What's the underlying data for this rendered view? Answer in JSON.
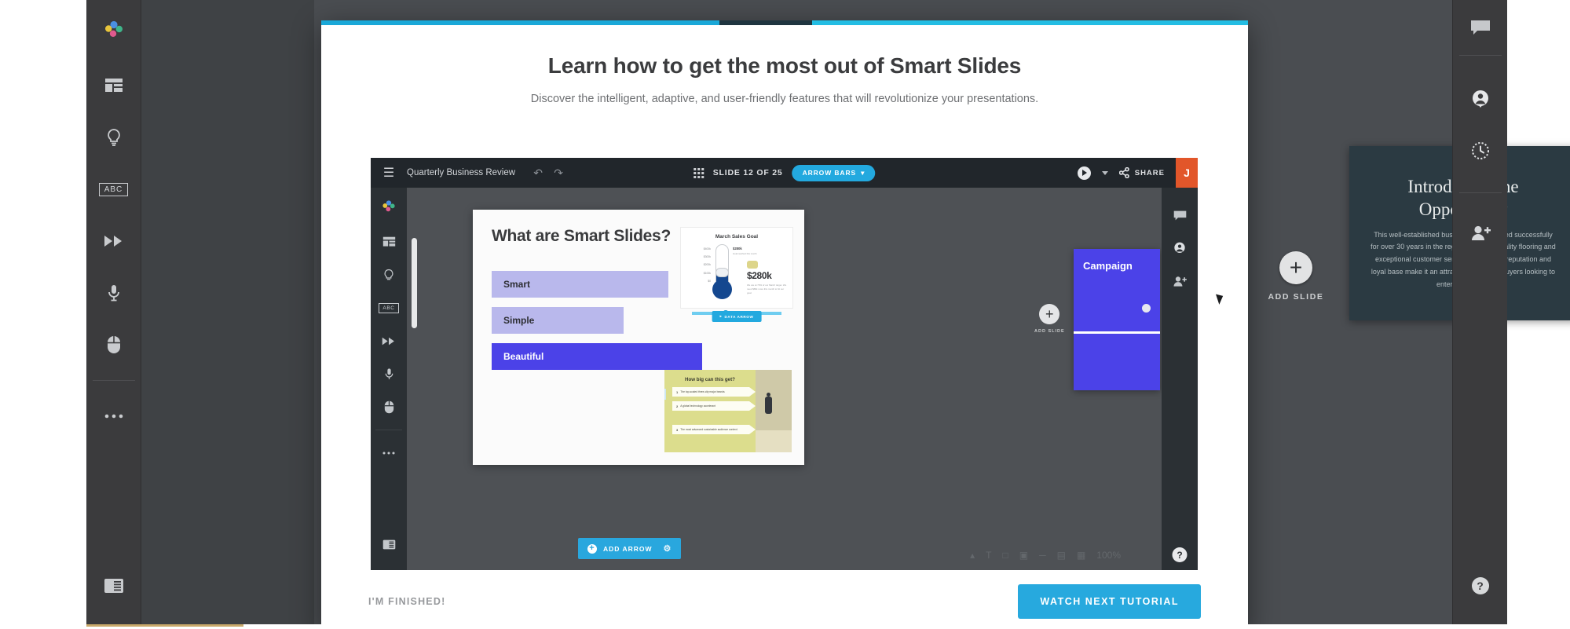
{
  "left_rail": {
    "items": [
      {
        "name": "app-logo-icon",
        "label": "Smart Slides"
      },
      {
        "name": "layouts-icon",
        "label": "Layouts"
      },
      {
        "name": "lightbulb-icon",
        "label": "Ideas"
      },
      {
        "name": "abc-icon",
        "label": "ABC"
      },
      {
        "name": "fast-forward-icon",
        "label": "Transitions"
      },
      {
        "name": "microphone-icon",
        "label": "Record"
      },
      {
        "name": "mouse-icon",
        "label": "Interact"
      },
      {
        "name": "more-options-icon",
        "label": "More"
      },
      {
        "name": "notes-panel-icon",
        "label": "Notes"
      }
    ]
  },
  "right_rail": {
    "items": [
      {
        "name": "comment-icon",
        "label": "Comments"
      },
      {
        "name": "account-icon",
        "label": "Account"
      },
      {
        "name": "history-icon",
        "label": "Version history"
      },
      {
        "name": "add-person-icon",
        "label": "Invite"
      },
      {
        "name": "help-icon",
        "label": "Help"
      }
    ]
  },
  "background": {
    "add_slide_label": "ADD SLIDE",
    "plus_glyph": "+",
    "dark_slide": {
      "title": "Introducing the Opportunity",
      "body": "This well-established business has operated successfully for over 30 years in the region with high quality flooring and exceptional customer service. The strong reputation and loyal base make it an attractive option for buyers looking to enter the market."
    }
  },
  "modal": {
    "title": "Learn how to get the most out of Smart Slides",
    "subtitle": "Discover the intelligent, adaptive, and user-friendly features that will revolutionize your presentations.",
    "finished_label": "I'M FINISHED!",
    "next_label": "WATCH NEXT TUTORIAL",
    "accent_color": "#27a9de"
  },
  "embed": {
    "topbar": {
      "menu_glyph": "☰",
      "doc_title": "Quarterly Business Review",
      "undo_glyph": "↶",
      "redo_glyph": "↷",
      "slide_counter": "SLIDE 12 OF 25",
      "mode_badge": "ARROW BARS",
      "badge_caret": "▾",
      "share_label": "SHARE",
      "avatar_initial": "J"
    },
    "rail": {
      "items": [
        {
          "name": "app-logo-icon",
          "label": "Smart Slides"
        },
        {
          "name": "layouts-icon",
          "label": "Layouts"
        },
        {
          "name": "lightbulb-icon",
          "label": "Ideas"
        },
        {
          "name": "abc-icon",
          "label": "ABC"
        },
        {
          "name": "fast-forward-icon",
          "label": "Transitions"
        },
        {
          "name": "microphone-icon",
          "label": "Record"
        },
        {
          "name": "mouse-icon",
          "label": "Interact"
        },
        {
          "name": "more-options-icon",
          "label": "More"
        },
        {
          "name": "notes-panel-icon",
          "label": "Notes"
        }
      ]
    },
    "slide": {
      "heading": "What are Smart Slides?",
      "bars": [
        {
          "label": "Smart",
          "width_pct": 84,
          "color": "#b9b8ec"
        },
        {
          "label": "Simple",
          "width_pct": 62,
          "color": "#b9b8ec"
        },
        {
          "label": "Beautiful",
          "width_pct": 100,
          "color": "#4b42e8"
        }
      ]
    },
    "thermometer": {
      "title": "March Sales Goal",
      "callout": "$280k",
      "callout_caption": "Goal reached this month",
      "value": "$280k",
      "description": "We are at 70% of our March target. We need $80k more this month to hit our goal.",
      "axis": [
        "$400k",
        "$300k",
        "$200k",
        "$100k",
        "$0"
      ],
      "fill_pct": 70,
      "pill_label": "DATA ARROW"
    },
    "yellow_card": {
      "title": "How big can this get?",
      "items": [
        {
          "num": "1",
          "text": "The top-scaled three-city major brands"
        },
        {
          "num": "2",
          "text": "A global technology accelerant"
        },
        {
          "num": "3",
          "text": "The most advanced sustainable audience context"
        }
      ]
    },
    "add_arrow_button": {
      "label": "ADD ARROW",
      "plus_glyph": "+",
      "gear_glyph": "⚙"
    },
    "mini_panel": {
      "add_slide_label": "ADD SLIDE",
      "plus_glyph": "+",
      "blue_slide_title": "Campaign"
    },
    "help_glyph": "?"
  }
}
